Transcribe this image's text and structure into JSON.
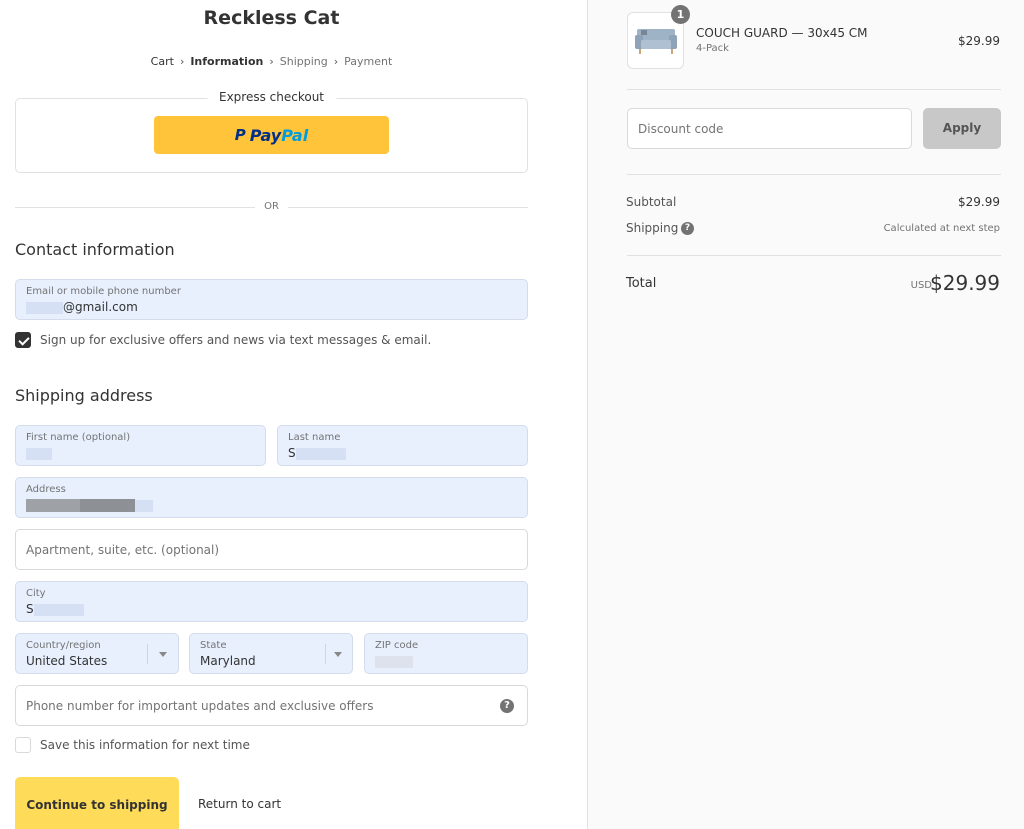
{
  "shop": {
    "name": "Reckless Cat"
  },
  "breadcrumb": [
    {
      "label": "Cart",
      "state": "done"
    },
    {
      "label": "Information",
      "state": "current"
    },
    {
      "label": "Shipping",
      "state": "upcoming"
    },
    {
      "label": "Payment",
      "state": "upcoming"
    }
  ],
  "express": {
    "label": "Express checkout",
    "paypal": {
      "mark": "P",
      "pay": "Pay",
      "pal": "Pal"
    }
  },
  "divider": {
    "label": "OR"
  },
  "contact": {
    "title": "Contact information",
    "email": {
      "label": "Email or mobile phone number",
      "value": "@gmail.com"
    },
    "marketing_opt_in": {
      "label": "Sign up for exclusive offers and news via text messages & email.",
      "checked": true
    }
  },
  "shipping": {
    "title": "Shipping address",
    "first_name": {
      "label": "First name (optional)",
      "value": ""
    },
    "last_name": {
      "label": "Last name",
      "value": "S"
    },
    "address": {
      "label": "Address",
      "value": ""
    },
    "apartment": {
      "placeholder": "Apartment, suite, etc. (optional)"
    },
    "city": {
      "label": "City",
      "value": "S"
    },
    "country": {
      "label": "Country/region",
      "value": "United States"
    },
    "state": {
      "label": "State",
      "value": "Maryland"
    },
    "zip": {
      "label": "ZIP code",
      "value": ""
    },
    "phone": {
      "placeholder": "Phone number for important updates and exclusive offers",
      "help_icon": "question-circle-icon"
    },
    "save_info": {
      "label": "Save this information for next time",
      "checked": false
    }
  },
  "actions": {
    "continue_label": "Continue to shipping",
    "return_label": "Return to cart"
  },
  "summary": {
    "item": {
      "quantity": "1",
      "name": "COUCH GUARD — 30x45 CM",
      "variant": "4-Pack",
      "price": "$29.99"
    },
    "discount": {
      "placeholder": "Discount code",
      "apply_label": "Apply"
    },
    "subtotal": {
      "label": "Subtotal",
      "value": "$29.99"
    },
    "shipping": {
      "label": "Shipping",
      "value": "Calculated at next step"
    },
    "total": {
      "label": "Total",
      "currency": "USD",
      "value": "$29.99"
    }
  },
  "colors": {
    "paypal_button": "#ffc439",
    "continue_button": "#fedc5a",
    "autofill_background": "#e8f0fe",
    "apply_button": "#c8c8c8"
  }
}
